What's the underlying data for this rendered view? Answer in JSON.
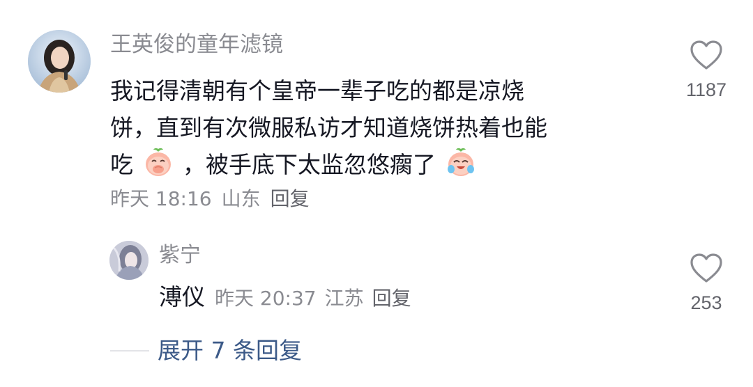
{
  "comment": {
    "author": "王英俊的童年滤镜",
    "text_lines": [
      "我记得清朝有个皇帝一辈子吃的都是凉烧",
      "饼，直到有次微服私访才知道烧饼热着也能",
      "吃",
      "，被手底下太监忽悠瘸了"
    ],
    "time": "昨天 18:16",
    "location": "山东",
    "reply_label": "回复",
    "like_count": "1187",
    "emojis": [
      "cover-mouth-peach-emoji",
      "crying-laughing-peach-emoji"
    ]
  },
  "reply": {
    "author": "紫宁",
    "text": "溥仪",
    "time": "昨天 20:37",
    "location": "江苏",
    "reply_label": "回复",
    "like_count": "253"
  },
  "expand": {
    "label": "展开 7 条回复"
  },
  "icons": [
    "heart-icon"
  ],
  "colors": {
    "text": "#161823",
    "secondary": "#8a8b91",
    "link": "#3c5a88"
  }
}
